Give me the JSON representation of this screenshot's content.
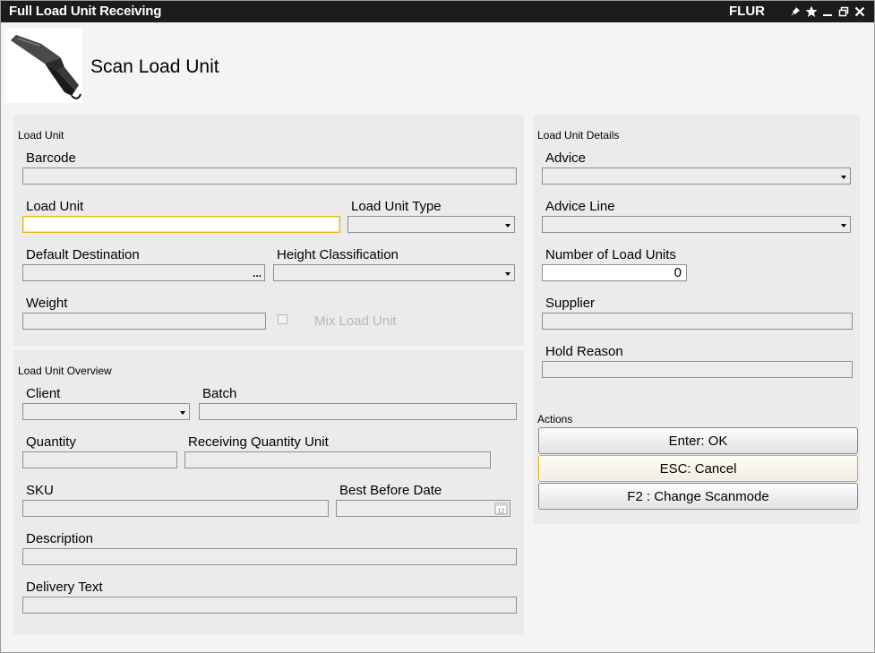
{
  "window": {
    "title": "Full Load Unit Receiving",
    "site": "FLUR",
    "icons": [
      "pin-icon",
      "star-icon",
      "minimize-icon",
      "restore-icon",
      "close-icon"
    ]
  },
  "header": {
    "image": "barcode-scanner-image",
    "title": "Scan Load Unit"
  },
  "load_unit": {
    "section_title": "Load Unit",
    "barcode_label": "Barcode",
    "barcode_value": "",
    "load_unit_label": "Load Unit",
    "load_unit_value": "",
    "load_unit_type_label": "Load Unit Type",
    "load_unit_type_value": "",
    "default_destination_label": "Default Destination",
    "default_destination_value": "",
    "browse_button": "...",
    "height_classification_label": "Height Classification",
    "height_classification_value": "",
    "weight_label": "Weight",
    "weight_value": "",
    "mix_load_unit_label": "Mix Load Unit",
    "mix_load_unit_checked": false
  },
  "overview": {
    "section_title": "Load Unit Overview",
    "client_label": "Client",
    "client_value": "",
    "batch_label": "Batch",
    "batch_value": "",
    "quantity_label": "Quantity",
    "quantity_value": "",
    "receiving_quantity_unit_label": "Receiving Quantity Unit",
    "receiving_quantity_unit_value": "",
    "sku_label": "SKU",
    "sku_value": "",
    "best_before_date_label": "Best Before Date",
    "best_before_date_value": "",
    "calendar_icon_text": "12",
    "description_label": "Description",
    "description_value": "",
    "delivery_text_label": "Delivery Text",
    "delivery_text_value": ""
  },
  "details": {
    "section_title": "Load Unit Details",
    "advice_label": "Advice",
    "advice_value": "",
    "advice_line_label": "Advice Line",
    "advice_line_value": "",
    "number_of_load_units_label": "Number of Load Units",
    "number_of_load_units_value": "0",
    "supplier_label": "Supplier",
    "supplier_value": "",
    "hold_reason_label": "Hold Reason",
    "hold_reason_value": ""
  },
  "actions": {
    "section_title": "Actions",
    "ok": "Enter: OK",
    "cancel": "ESC: Cancel",
    "change_scanmode": "F2 : Change Scanmode"
  },
  "colors": {
    "titlebar": "#1c1c1c",
    "panel": "#ebebeb",
    "focus_border": "#e6b800",
    "field_border": "#8a8f9c"
  }
}
